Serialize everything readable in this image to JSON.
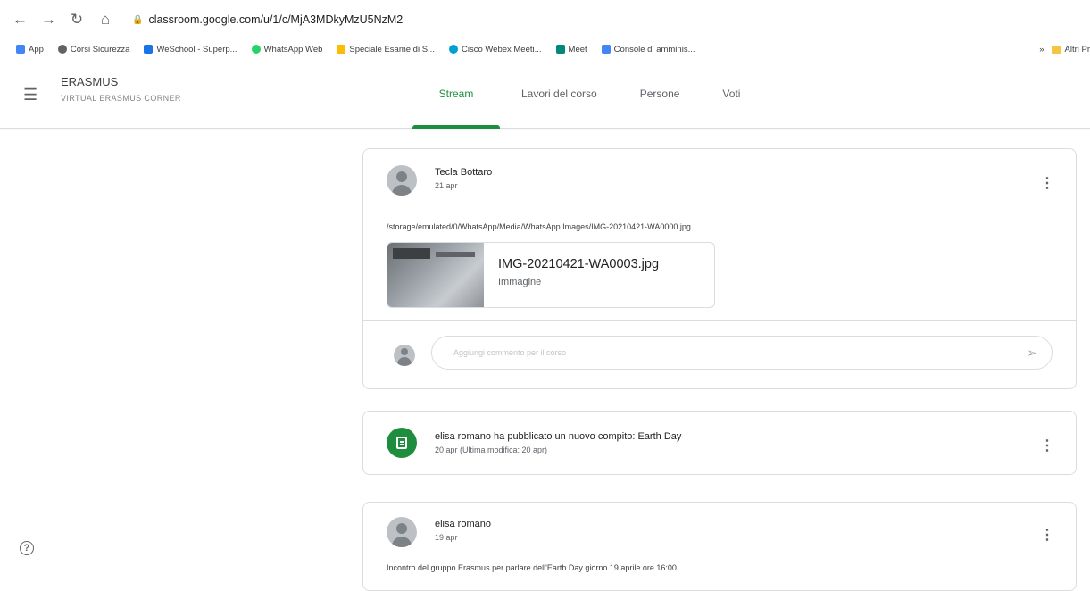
{
  "browser": {
    "url": "classroom.google.com/u/1/c/MjA3MDkyMzU5NzM2",
    "bookmarks": [
      {
        "label": "App",
        "color": "#4285f4"
      },
      {
        "label": "Corsi Sicurezza",
        "color": "#5f6368"
      },
      {
        "label": "WeSchool - Superp...",
        "color": "#1a73e8"
      },
      {
        "label": "WhatsApp Web",
        "color": "#25d366"
      },
      {
        "label": "Speciale Esame di S...",
        "color": "#fbbc04"
      },
      {
        "label": "Cisco Webex Meeti...",
        "color": "#00a0d1"
      },
      {
        "label": "Meet",
        "color": "#00897b"
      },
      {
        "label": "Console di amminis...",
        "color": "#4285f4"
      }
    ],
    "more": "»",
    "other_bookmarks": "Altri Pr"
  },
  "header": {
    "course_title": "ERASMUS",
    "course_subtitle": "VIRTUAL ERASMUS CORNER",
    "tabs": [
      {
        "label": "Stream",
        "active": true
      },
      {
        "label": "Lavori del corso",
        "active": false
      },
      {
        "label": "Persone",
        "active": false
      },
      {
        "label": "Voti",
        "active": false
      }
    ]
  },
  "posts": [
    {
      "author": "Tecla Bottaro",
      "date": "21 apr",
      "text": "/storage/emulated/0/WhatsApp/Media/WhatsApp Images/IMG-20210421-WA0000.jpg",
      "attachment": {
        "name": "IMG-20210421-WA0003.jpg",
        "type": "Immagine"
      },
      "comment_placeholder": "Aggiungi commento per il corso"
    },
    {
      "text": "elisa romano ha pubblicato un nuovo compito: Earth Day",
      "date": "20 apr (Ultima modifica: 20 apr)"
    },
    {
      "author": "elisa romano",
      "date": "19 apr",
      "text": "Incontro del gruppo Erasmus  per parlare dell'Earth Day giorno 19 aprile ore 16:00"
    }
  ],
  "colors": {
    "accent": "#1e8e3e"
  }
}
